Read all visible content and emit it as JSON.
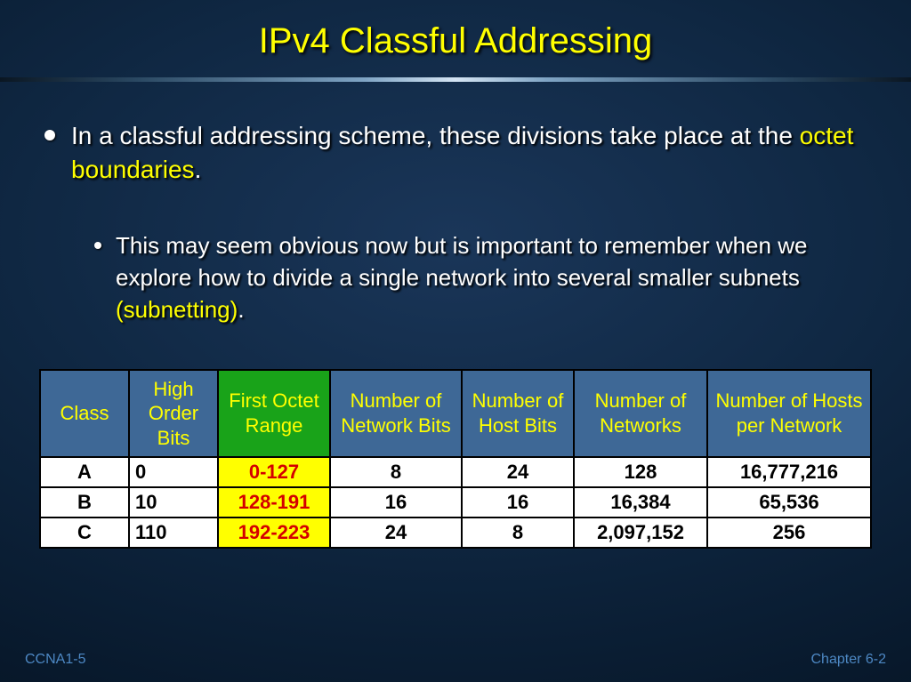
{
  "title": "IPv4 Classful Addressing",
  "bullet_main": {
    "pre": "In a classful addressing scheme, these divisions take place at the ",
    "hl": "octet boundaries",
    "post": "."
  },
  "bullet_sub": {
    "pre": "This may seem obvious now but is important to remember when we explore how to divide a single network into several smaller subnets ",
    "hl": "(subnetting)",
    "post": "."
  },
  "table": {
    "headers": {
      "h1": "Class",
      "h2": "High Order Bits",
      "h3": "First Octet Range",
      "h4": "Number of Network Bits",
      "h5": "Number of Host Bits",
      "h6": "Number of Networks",
      "h7": "Number of Hosts per Network"
    },
    "rows": [
      {
        "class": "A",
        "hob": "0",
        "range": "0-127",
        "netbits": "8",
        "hostbits": "24",
        "nets": "128",
        "hosts": "16,777,216"
      },
      {
        "class": "B",
        "hob": "10",
        "range": "128-191",
        "netbits": "16",
        "hostbits": "16",
        "nets": "16,384",
        "hosts": "65,536"
      },
      {
        "class": "C",
        "hob": "110",
        "range": "192-223",
        "netbits": "24",
        "hostbits": "8",
        "nets": "2,097,152",
        "hosts": "256"
      }
    ]
  },
  "footer": {
    "left": "CCNA1-5",
    "right": "Chapter 6-2"
  }
}
